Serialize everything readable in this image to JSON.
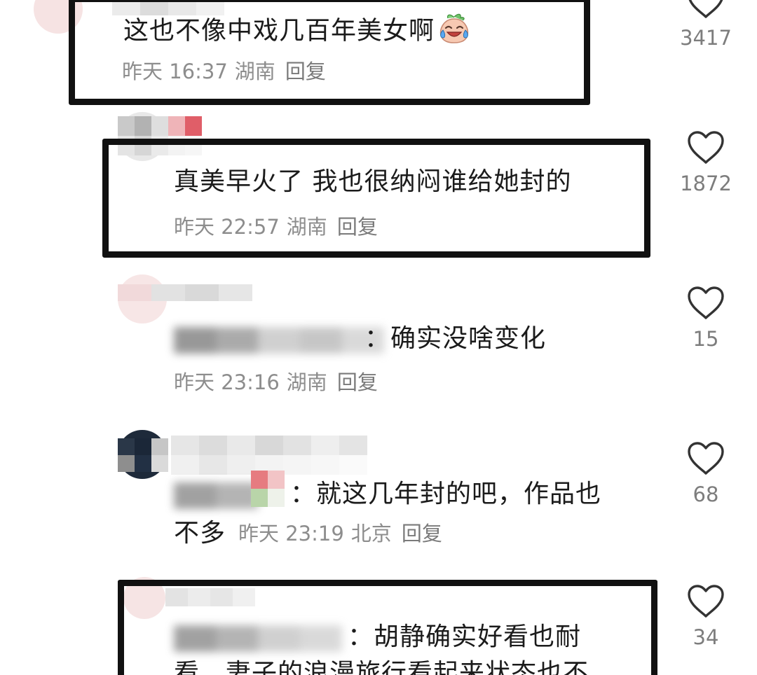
{
  "comments": [
    {
      "text": "这也不像中戏几百年美女啊",
      "time": "昨天 16:37",
      "location": "湖南",
      "reply_label": "回复",
      "likes": "3417"
    },
    {
      "text": "真美早火了 我也很纳闷谁给她封的",
      "time": "昨天 22:57",
      "location": "湖南",
      "reply_label": "回复",
      "likes": "1872"
    },
    {
      "text": "确实没啥变化",
      "time": "昨天 23:16",
      "location": "湖南",
      "reply_label": "回复",
      "likes": "15"
    },
    {
      "text_line1": "就这几年封的吧，作品也",
      "text_line2": "不多",
      "time": "昨天 23:19",
      "location": "北京",
      "reply_label": "回复",
      "likes": "68"
    },
    {
      "text_line1": "胡静确实好看也耐",
      "text_line2": "看。妻子的浪漫旅行看起来状态也不",
      "likes": "34"
    }
  ],
  "icons": {
    "like": "heart-outline-icon",
    "emoji": "crying-laughing-peach-emoji"
  },
  "colors": {
    "annotation_border": "#111111",
    "text": "#1b1b1b",
    "meta": "#8d8d8d"
  }
}
